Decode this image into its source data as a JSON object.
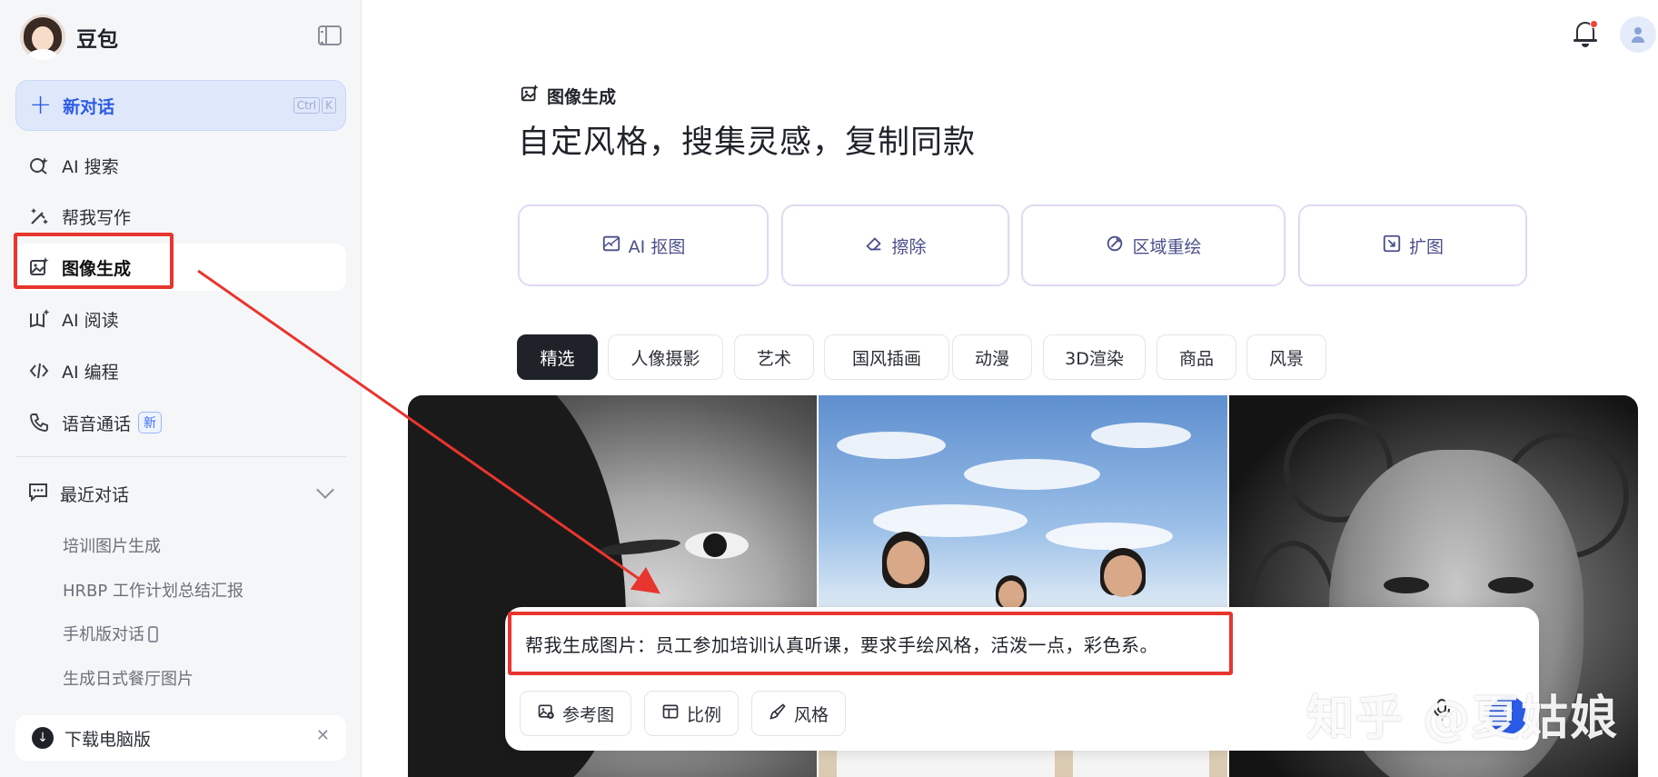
{
  "app": {
    "name": "豆包"
  },
  "sidebar": {
    "new_chat": {
      "label": "新对话",
      "shortcut": [
        "Ctrl",
        "K"
      ]
    },
    "items": [
      {
        "label": "AI 搜索",
        "icon": "search-sparkle-icon"
      },
      {
        "label": "帮我写作",
        "icon": "pen-sparkle-icon"
      },
      {
        "label": "图像生成",
        "icon": "image-sparkle-icon",
        "active": true
      },
      {
        "label": "AI 阅读",
        "icon": "book-sparkle-icon"
      },
      {
        "label": "AI 编程",
        "icon": "code-icon"
      },
      {
        "label": "语音通话",
        "icon": "phone-icon",
        "badge": "新"
      }
    ],
    "recent": {
      "title": "最近对话",
      "items": [
        "培训图片生成",
        "HRBP 工作计划总结汇报",
        "手机版对话",
        "生成日式餐厅图片"
      ]
    },
    "download": {
      "label": "下载电脑版"
    }
  },
  "main": {
    "section_tag": "图像生成",
    "title": "自定风格，搜集灵感，复制同款",
    "tools": [
      {
        "label": "AI 抠图",
        "icon": "cutout-icon"
      },
      {
        "label": "擦除",
        "icon": "eraser-icon"
      },
      {
        "label": "区域重绘",
        "icon": "brush-icon"
      },
      {
        "label": "扩图",
        "icon": "expand-icon"
      }
    ],
    "categories": [
      "精选",
      "人像摄影",
      "艺术",
      "国风插画",
      "动漫",
      "3D渲染",
      "商品",
      "风景"
    ],
    "selected_category": "精选",
    "prompt": {
      "text": "帮我生成图片：员工参加培训认真听课，要求手绘风格，活泼一点，彩色系。",
      "chips": [
        {
          "label": "参考图",
          "icon": "image-add-icon"
        },
        {
          "label": "比例",
          "icon": "ratio-icon"
        },
        {
          "label": "风格",
          "icon": "brush-icon"
        }
      ]
    }
  },
  "watermark": "知乎 @夏姑娘",
  "colors": {
    "accent": "#2b5be6",
    "annotation": "#e8352e",
    "sidebar_bg": "#f5f6f8"
  }
}
